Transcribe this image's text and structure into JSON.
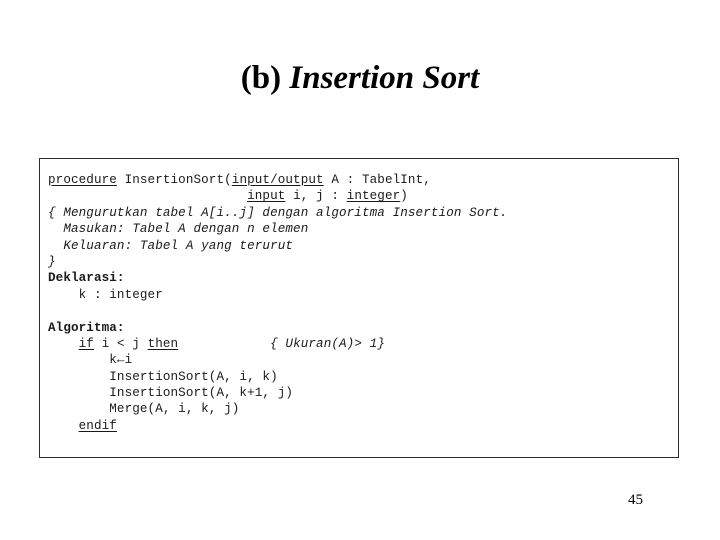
{
  "slide": {
    "title_prefix": "(b) ",
    "title_main": "Insertion Sort",
    "page_number": "45"
  },
  "code": {
    "lines": [
      [
        {
          "t": "procedure",
          "s": "kw"
        },
        {
          "t": " InsertionSort(",
          "s": "plain"
        },
        {
          "t": "input/output",
          "s": "kw"
        },
        {
          "t": " A : TabelInt,",
          "s": "plain"
        }
      ],
      [
        {
          "t": "                          ",
          "s": "plain"
        },
        {
          "t": "input",
          "s": "kw"
        },
        {
          "t": " i, j : ",
          "s": "plain"
        },
        {
          "t": "integer",
          "s": "kw"
        },
        {
          "t": ")",
          "s": "plain"
        }
      ],
      [
        {
          "t": "{ Mengurutkan tabel A[i..j] dengan algoritma Insertion Sort.",
          "s": "cmt"
        }
      ],
      [
        {
          "t": "  Masukan: Tabel A dengan n elemen",
          "s": "cmt"
        }
      ],
      [
        {
          "t": "  Keluaran: Tabel A yang terurut",
          "s": "cmt"
        }
      ],
      [
        {
          "t": "}",
          "s": "cmt"
        }
      ],
      [
        {
          "t": "Deklarasi:",
          "s": "bold"
        }
      ],
      [
        {
          "t": "    k : integer",
          "s": "plain"
        }
      ],
      [],
      [
        {
          "t": "Algoritma:",
          "s": "bold"
        }
      ],
      [
        {
          "t": "    ",
          "s": "plain"
        },
        {
          "t": "if",
          "s": "kw"
        },
        {
          "t": " i < j ",
          "s": "plain"
        },
        {
          "t": "then",
          "s": "kw"
        },
        {
          "t": "            ",
          "s": "plain"
        },
        {
          "t": "{ Ukuran(A)> 1}",
          "s": "cmt"
        }
      ],
      [
        {
          "t": "        k←i",
          "s": "plain"
        }
      ],
      [
        {
          "t": "        InsertionSort(A, i, k)",
          "s": "plain"
        }
      ],
      [
        {
          "t": "        InsertionSort(A, k+1, j)",
          "s": "plain"
        }
      ],
      [
        {
          "t": "        Merge(A, i, k, j)",
          "s": "plain"
        }
      ],
      [
        {
          "t": "    ",
          "s": "plain"
        },
        {
          "t": "endif",
          "s": "kw"
        }
      ]
    ]
  }
}
